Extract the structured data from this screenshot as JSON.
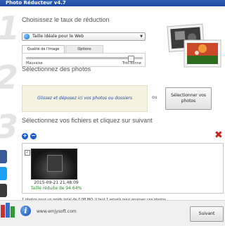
{
  "window": {
    "title": "Photo Réducteur v4.7"
  },
  "steps": {
    "one": {
      "number": "1",
      "heading": "Choisissez le taux de réduction"
    },
    "two": {
      "number": "2",
      "heading": "Sélectionnez des photos"
    },
    "three": {
      "number": "3",
      "heading": "Sélectionnez vos fichiers et cliquez sur suivant"
    }
  },
  "size_combo": {
    "selected": "Taille idéale pour le Web",
    "icon": "globe-icon"
  },
  "tabs": [
    {
      "label": "Qualité de l'image",
      "active": true
    },
    {
      "label": "Options",
      "active": false
    }
  ],
  "quality_slider": {
    "min_label": "Mauvaise",
    "max_label": "Très bonne",
    "level": 0.9
  },
  "drop_zone": {
    "text": "Glissez et déposez ici vos photos ou dossiers"
  },
  "or_text": "ou",
  "select_button": {
    "label": "Sélectionner vos photos"
  },
  "list_toolbar": {
    "add_icon": "plus-icon",
    "remove_icon": "minus-icon",
    "delete_all_icon": "red-x-icon"
  },
  "files": [
    {
      "checked": true,
      "date": "2015-09-21 21.48.09",
      "reduction": "Taille réduite de 94.64%"
    }
  ],
  "status_text": "1 photos pour un poids total de 0.08 MO. Il faut 1 emails pour envoyer ces photos.",
  "footer": {
    "website": "www.emjysoft.com",
    "next_button": "Suivant",
    "info_icon": "info-icon"
  },
  "social": [
    "facebook-icon",
    "twitter-icon",
    "google-plus-icon"
  ],
  "colors": {
    "accent": "#1f4d98",
    "success": "#2a8a2a",
    "danger": "#c82222"
  }
}
